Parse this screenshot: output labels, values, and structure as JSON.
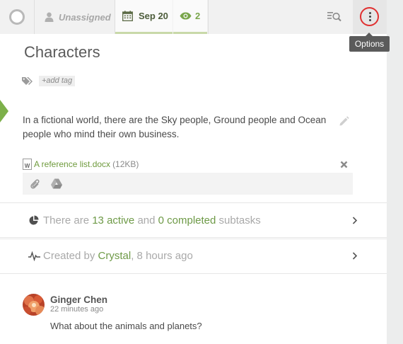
{
  "topbar": {
    "assignee_label": "Unassigned",
    "date_label": "Sep 20",
    "followers_count": "2",
    "options_tooltip": "Options"
  },
  "task": {
    "title": "Characters",
    "add_tag_label": "+add tag",
    "description": "In a fictional world, there are the Sky people, Ground people and Ocean people who mind their own business."
  },
  "attachment": {
    "file_name": "A reference list.docx",
    "file_size": "(12KB)",
    "file_type_letter": "W"
  },
  "subtasks": {
    "prefix": "There are",
    "active_count": "13 active",
    "mid": "and",
    "completed_count": "0 completed",
    "suffix": "subtasks"
  },
  "activity": {
    "prefix": "Created by",
    "author": "Crystal",
    "suffix": ", 8 hours ago"
  },
  "comment": {
    "author": "Ginger Chen",
    "time": "22 minutes ago",
    "body": "What about the animals and planets?"
  },
  "colors": {
    "accent_green": "#6e9a47",
    "highlight_ring": "#e02f2f",
    "tooltip_bg": "#5b5b5b"
  },
  "icons": [
    "status-circle-icon",
    "user-icon",
    "calendar-icon",
    "eye-icon",
    "search-list-icon",
    "more-vertical-icon",
    "tag-icon",
    "pencil-icon",
    "word-doc-icon",
    "close-icon",
    "paperclip-icon",
    "google-drive-icon",
    "pie-chart-icon",
    "activity-icon",
    "chevron-right-icon"
  ]
}
